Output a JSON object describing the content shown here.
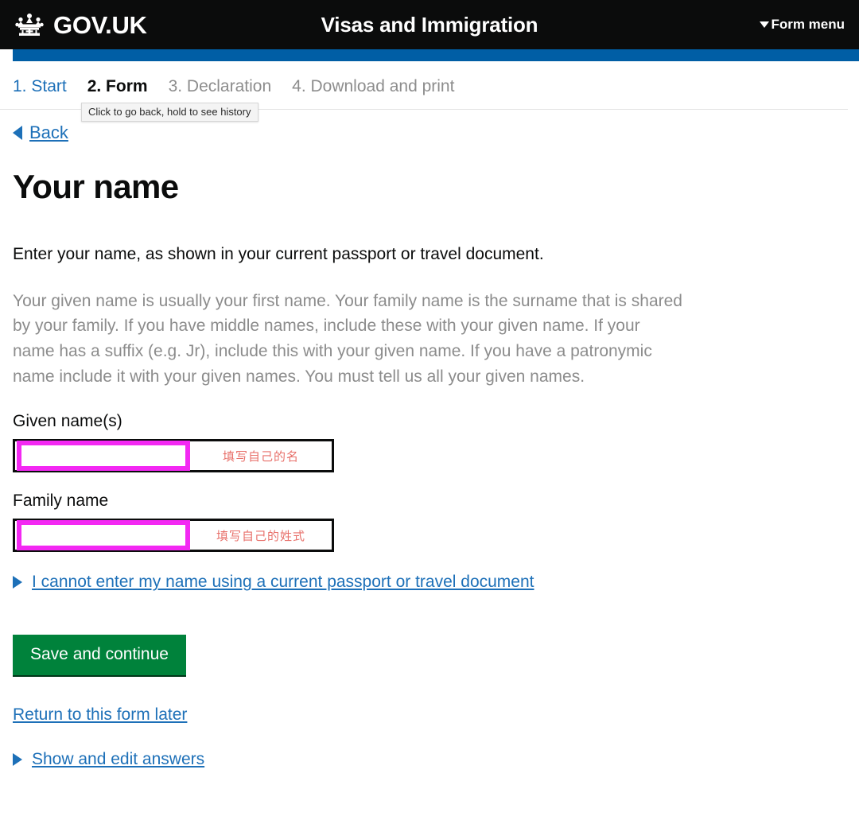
{
  "header": {
    "brand": "GOV.UK",
    "crown_icon": "crown-icon",
    "service_title": "Visas and Immigration",
    "form_menu_label": "Form menu",
    "caret_icon": "chevron-down-icon",
    "background_color": "#0b0c0c"
  },
  "progress": {
    "band_color": "#005ea5",
    "steps": [
      {
        "label": "1. Start",
        "state": "link"
      },
      {
        "label": "2. Form",
        "state": "current"
      },
      {
        "label": "3. Declaration",
        "state": "future"
      },
      {
        "label": "4. Download and print",
        "state": "future"
      }
    ]
  },
  "tooltip": {
    "text": "Click to go back, hold to see history"
  },
  "back": {
    "label": "Back",
    "icon": "caret-left-icon"
  },
  "main": {
    "title": "Your name",
    "lede": "Enter your name, as shown in your current passport or travel document.",
    "hint": "Your given name is usually your first name. Your family name is the surname that is shared by your family. If you have middle names, include these with your given name. If your name has a suffix (e.g. Jr), include this with your given name. If you have a patronymic name include it with your given names. You must tell us all your given names."
  },
  "fields": [
    {
      "label": "Given name(s)",
      "value": "",
      "placeholder": "",
      "annotation": "填写自己的名",
      "highlight_color": "#f328f3",
      "annotation_color": "#e8716b"
    },
    {
      "label": "Family name",
      "value": "",
      "placeholder": "",
      "annotation": "填写自己的姓式",
      "highlight_color": "#f328f3",
      "annotation_color": "#e8716b"
    }
  ],
  "details": {
    "label": "I cannot enter my name using a current passport or travel document",
    "icon": "caret-right-icon"
  },
  "actions": {
    "save_label": "Save and continue",
    "save_color": "#00823b",
    "return_label": "Return to this form later",
    "show_answers_label": "Show and edit answers",
    "show_answers_icon": "caret-right-icon"
  }
}
